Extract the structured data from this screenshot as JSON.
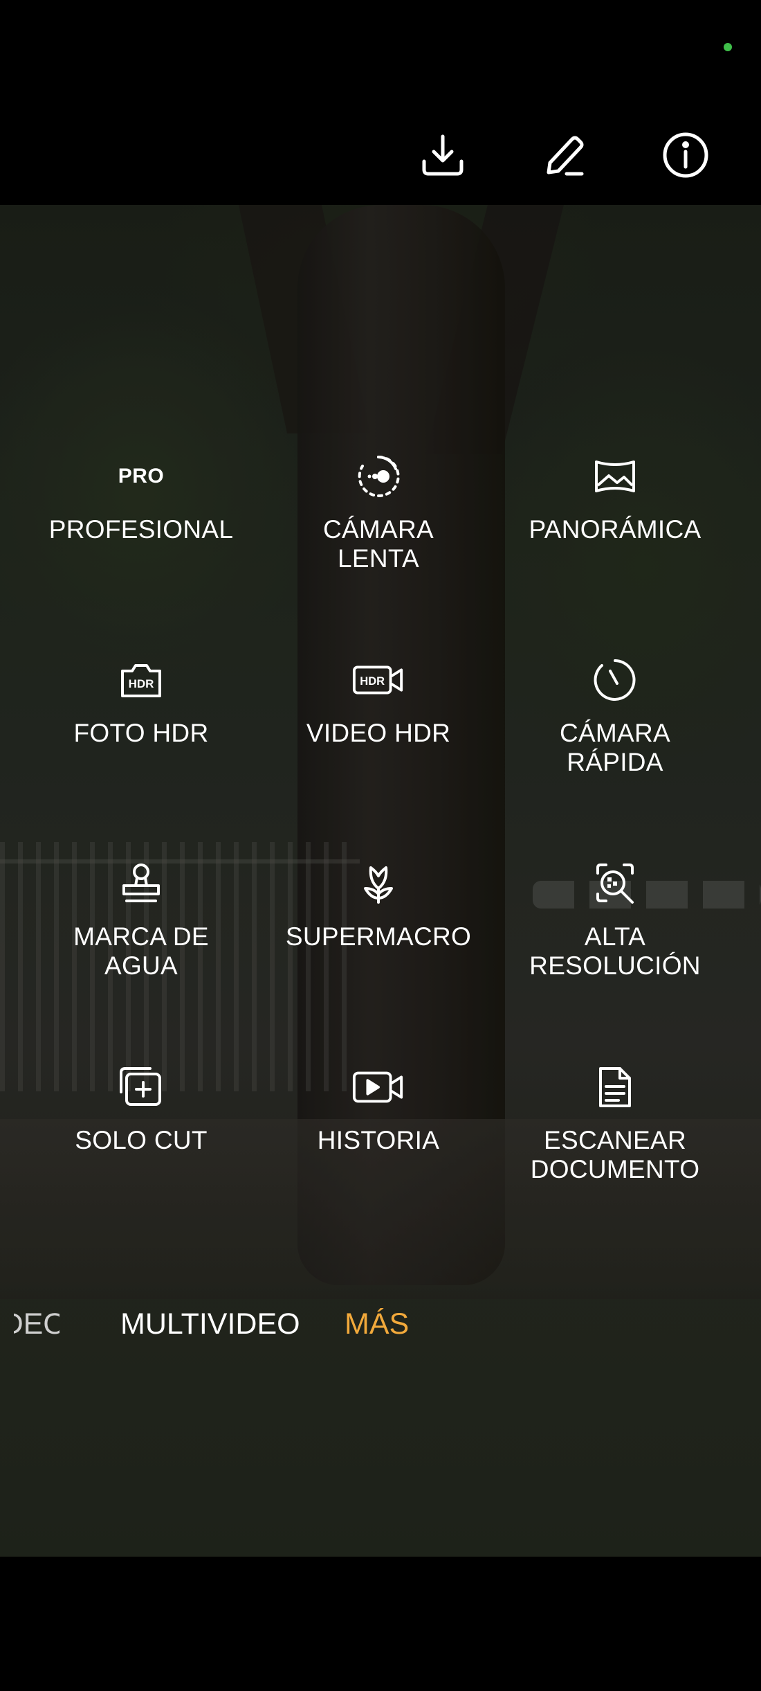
{
  "colors": {
    "accent": "#f2a93b",
    "status_dot": "#3fbf4a",
    "text": "#ffffff"
  },
  "top_bar": {
    "icons": [
      "download-icon",
      "edit-pencil-icon",
      "info-icon"
    ]
  },
  "modes": [
    {
      "icon": "pro-text-icon",
      "icon_text": "PRO",
      "label": "PROFESIONAL"
    },
    {
      "icon": "slow-motion-icon",
      "label": "CÁMARA\nLENTA"
    },
    {
      "icon": "panorama-icon",
      "label": "PANORÁMICA"
    },
    {
      "icon": "hdr-camera-icon",
      "icon_text": "HDR",
      "label": "FOTO HDR"
    },
    {
      "icon": "hdr-video-icon",
      "icon_text": "HDR",
      "label": "VIDEO HDR"
    },
    {
      "icon": "timer-icon",
      "label": "CÁMARA\nRÁPIDA"
    },
    {
      "icon": "stamp-icon",
      "label": "MARCA DE\nAGUA"
    },
    {
      "icon": "flower-macro-icon",
      "label": "SUPERMACRO"
    },
    {
      "icon": "magnifier-icon",
      "label": "ALTA\nRESOLUCIÓN"
    },
    {
      "icon": "solo-cut-icon",
      "label": "SOLO CUT"
    },
    {
      "icon": "story-video-icon",
      "label": "HISTORIA"
    },
    {
      "icon": "document-icon",
      "label": "ESCANEAR\nDOCUMENTO"
    }
  ],
  "mode_strip": {
    "clipped": "VIDEO",
    "multivideo": "MULTIVIDEO",
    "mas": "MÁS"
  }
}
